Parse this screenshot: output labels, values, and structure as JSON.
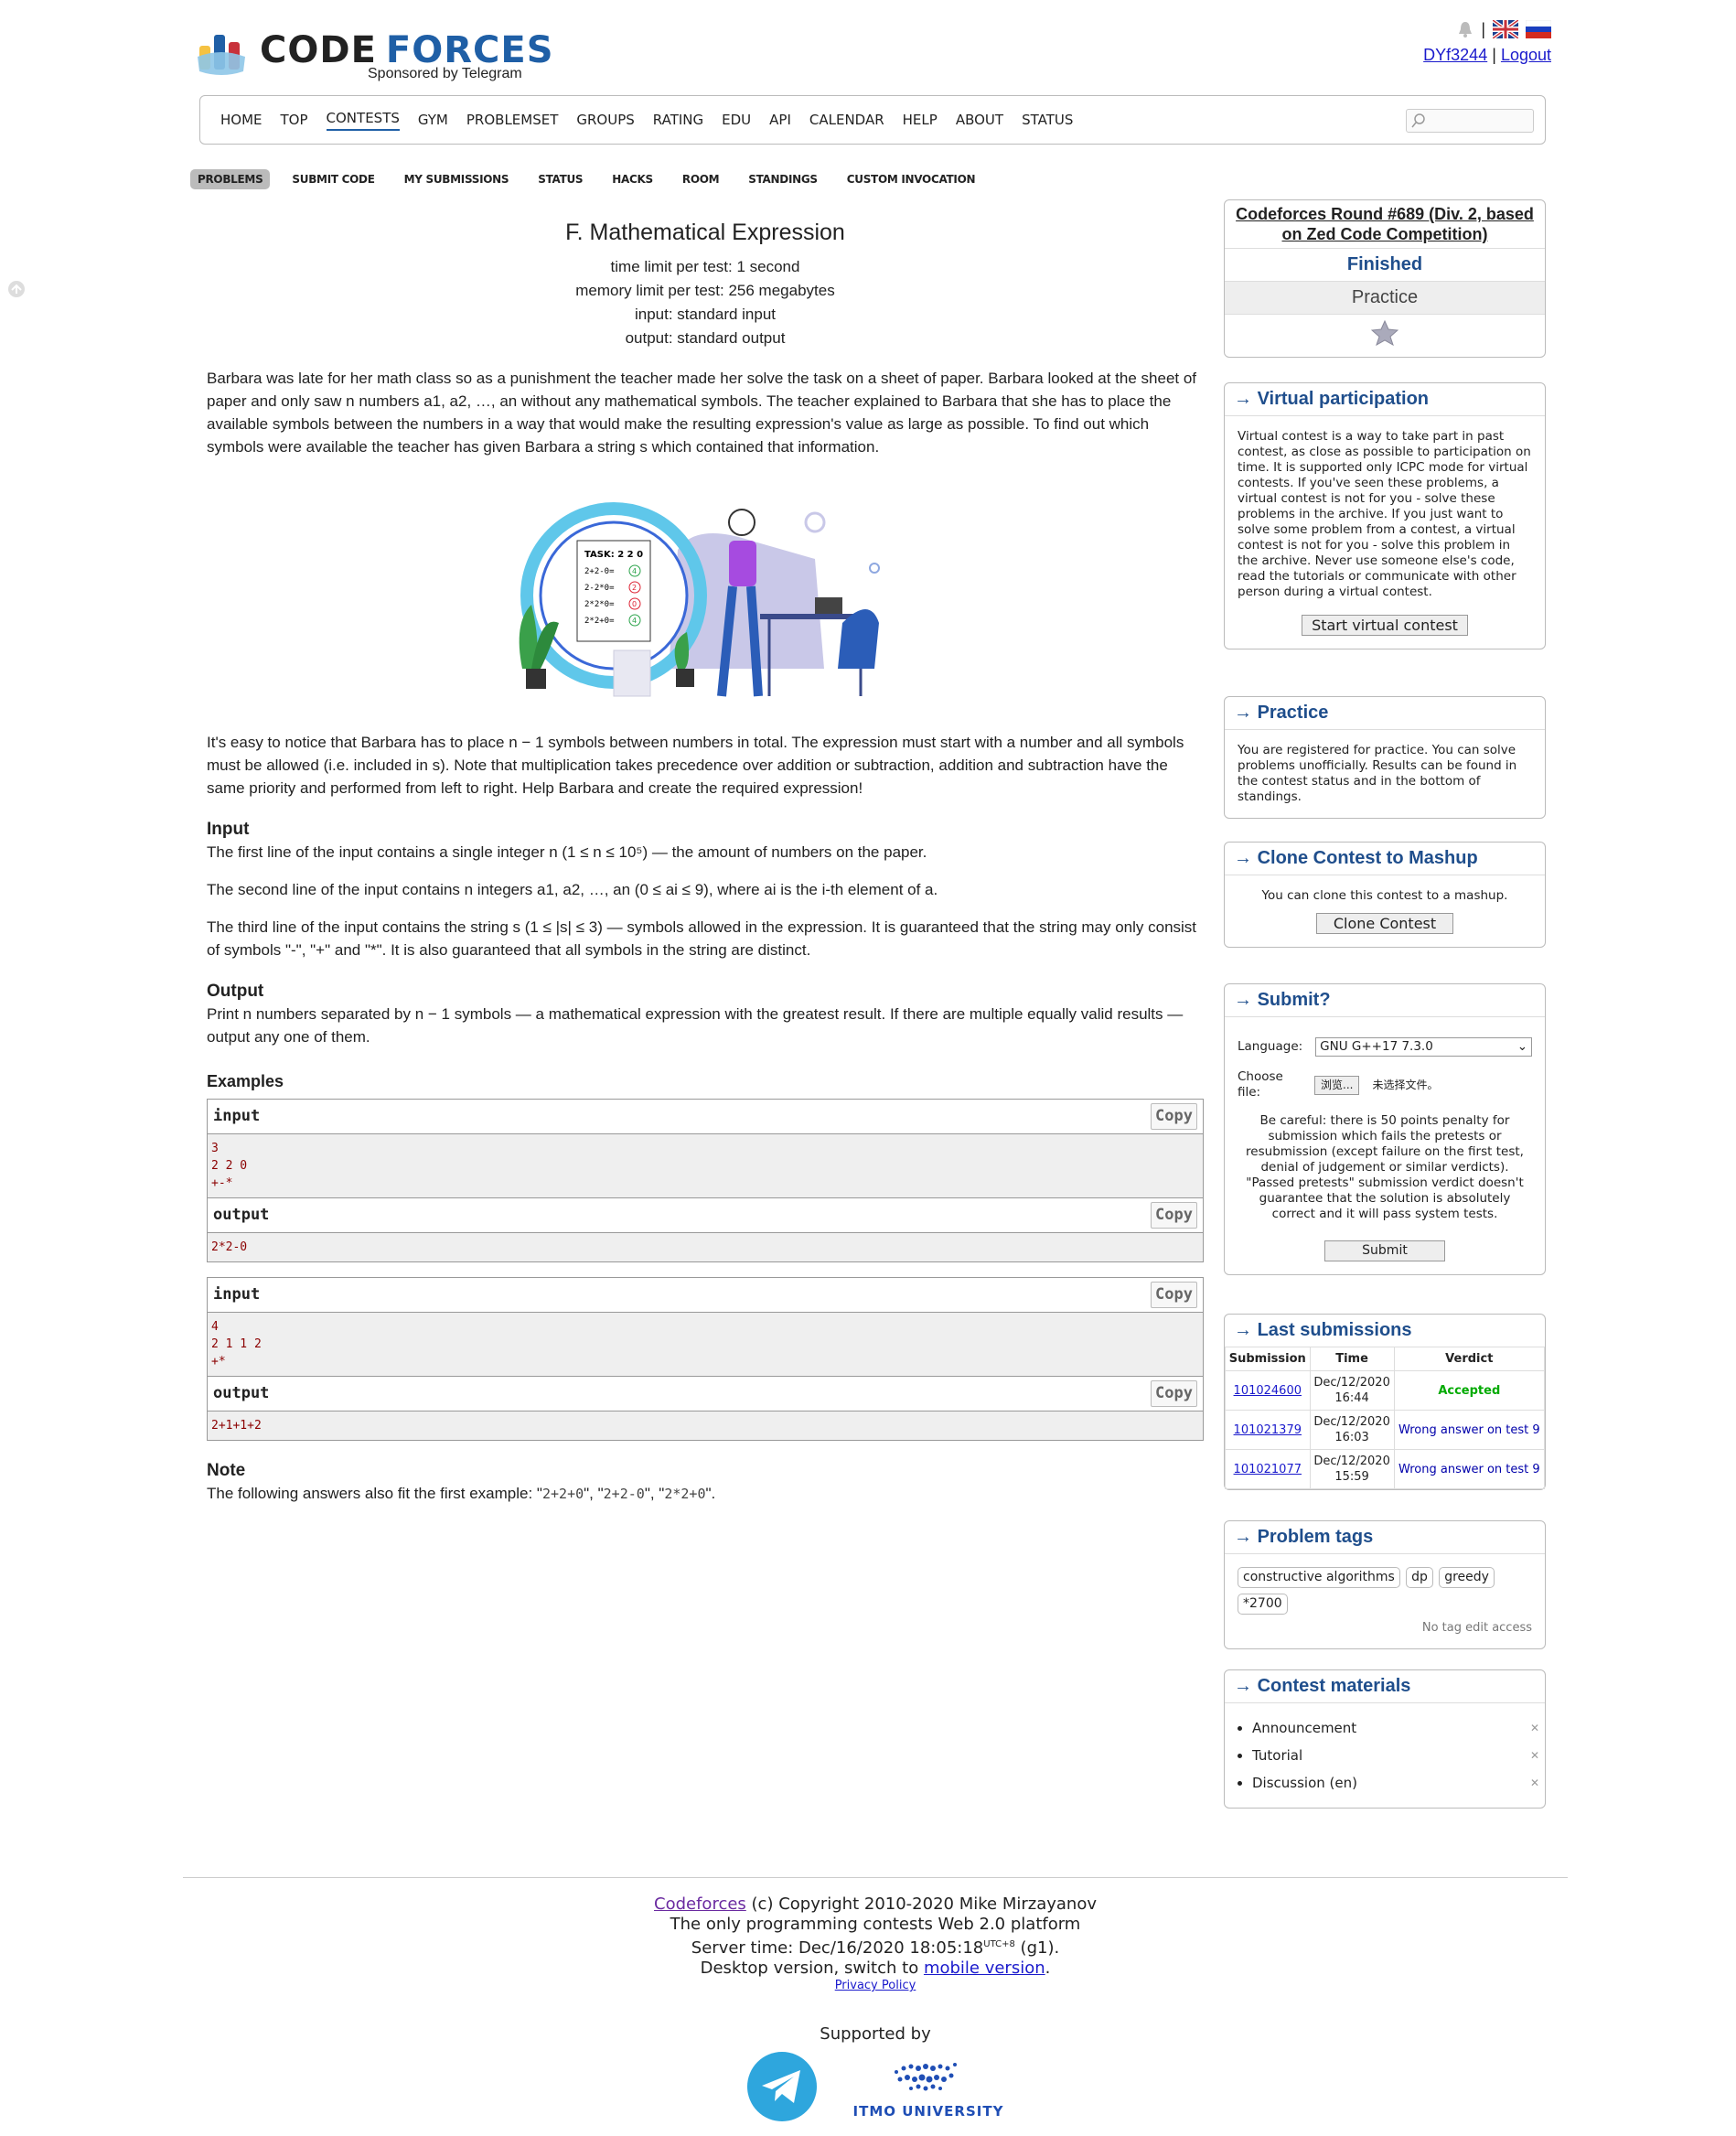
{
  "header": {
    "logo_word1": "CODE",
    "logo_word2": "FORCES",
    "sponsor": "Sponsored by Telegram",
    "username": "DYf3244",
    "separator": "|",
    "logout": "Logout"
  },
  "menu": {
    "items": [
      "HOME",
      "TOP",
      "CONTESTS",
      "GYM",
      "PROBLEMSET",
      "GROUPS",
      "RATING",
      "EDU",
      "API",
      "CALENDAR",
      "HELP",
      "ABOUT",
      "STATUS"
    ],
    "active": "CONTESTS"
  },
  "submenu": {
    "items": [
      "PROBLEMS",
      "SUBMIT CODE",
      "MY SUBMISSIONS",
      "STATUS",
      "HACKS",
      "ROOM",
      "STANDINGS",
      "CUSTOM INVOCATION"
    ],
    "active": "PROBLEMS"
  },
  "problem": {
    "title": "F. Mathematical Expression",
    "time_limit": "time limit per test: 1 second",
    "memory_limit": "memory limit per test: 256 megabytes",
    "input_file": "input: standard input",
    "output_file": "output: standard output",
    "legend1": "Barbara was late for her math class so as a punishment the teacher made her solve the task on a sheet of paper. Barbara looked at the sheet of paper and only saw n numbers a1, a2, …, an without any mathematical symbols. The teacher explained to Barbara that she has to place the available symbols between the numbers in a way that would make the resulting expression's value as large as possible. To find out which symbols were available the teacher has given Barbara a string s which contained that information.",
    "illustration_task": "TASK: 2 2 0",
    "illustration_lines": [
      "2+2-0=",
      "2-2*0=",
      "2*2*0=",
      "2*2+0="
    ],
    "illustration_results": [
      "4",
      "2",
      "0",
      "4"
    ],
    "legend2": "It's easy to notice that Barbara has to place n − 1 symbols between numbers in total. The expression must start with a number and all symbols must be allowed (i.e. included in s). Note that multiplication takes precedence over addition or subtraction, addition and subtraction have the same priority and performed from left to right. Help Barbara and create the required expression!",
    "input_title": "Input",
    "input1": "The first line of the input contains a single integer n (1 ≤ n ≤ 10⁵) — the amount of numbers on the paper.",
    "input2": "The second line of the input contains n integers a1, a2, …, an (0 ≤ ai ≤ 9), where ai is the i-th element of a.",
    "input3": "The third line of the input contains the string s (1 ≤ |s| ≤ 3) — symbols allowed in the expression. It is guaranteed that the string may only consist of symbols \"-\", \"+\" and \"*\". It is also guaranteed that all symbols in the string are distinct.",
    "output_title": "Output",
    "output1": "Print n numbers separated by n − 1 symbols — a mathematical expression with the greatest result. If there are multiple equally valid results — output any one of them.",
    "examples_title": "Examples",
    "input_label": "input",
    "output_label": "output",
    "copy_label": "Copy",
    "examples": [
      {
        "input": "3\n2 2 0\n+-*",
        "output": "2*2-0"
      },
      {
        "input": "4\n2 1 1 2\n+*",
        "output": "2+1+1+2"
      }
    ],
    "note_title": "Note",
    "note_prefix": "The following answers also fit the first example: \"",
    "note_a1": "2+2+0",
    "note_sep": "\", \"",
    "note_a2": "2+2-0",
    "note_a3": "2*2+0",
    "note_suffix": "\"."
  },
  "sidebar": {
    "round": {
      "name": "Codeforces Round #689 (Div. 2, based on Zed Code Competition)",
      "status": "Finished",
      "mode": "Practice"
    },
    "virtual": {
      "caption": "Virtual participation",
      "text": "Virtual contest is a way to take part in past contest, as close as possible to participation on time. It is supported only ICPC mode for virtual contests. If you've seen these problems, a virtual contest is not for you - solve these problems in the archive. If you just want to solve some problem from a contest, a virtual contest is not for you - solve this problem in the archive. Never use someone else's code, read the tutorials or communicate with other person during a virtual contest.",
      "button": "Start virtual contest"
    },
    "practice": {
      "caption": "Practice",
      "text": "You are registered for practice. You can solve problems unofficially. Results can be found in the contest status and in the bottom of standings."
    },
    "clone": {
      "caption": "Clone Contest to Mashup",
      "text": "You can clone this contest to a mashup.",
      "button": "Clone Contest"
    },
    "submit": {
      "caption": "Submit?",
      "language_label": "Language:",
      "language_value": "GNU G++17 7.3.0",
      "file_label": "Choose file:",
      "file_button": "浏览...",
      "file_none": "未选择文件。",
      "warning": "Be careful: there is 50 points penalty for submission which fails the pretests or resubmission (except failure on the first test, denial of judgement or similar verdicts). \"Passed pretests\" submission verdict doesn't guarantee that the solution is absolutely correct and it will pass system tests.",
      "button": "Submit"
    },
    "last": {
      "caption": "Last submissions",
      "headers": [
        "Submission",
        "Time",
        "Verdict"
      ],
      "rows": [
        {
          "id": "101024600",
          "date": "Dec/12/2020",
          "time": "16:44",
          "verdict": "Accepted",
          "ok": true
        },
        {
          "id": "101021379",
          "date": "Dec/12/2020",
          "time": "16:03",
          "verdict": "Wrong answer on test 9",
          "ok": false
        },
        {
          "id": "101021077",
          "date": "Dec/12/2020",
          "time": "15:59",
          "verdict": "Wrong answer on test 9",
          "ok": false
        }
      ]
    },
    "tags": {
      "caption": "Problem tags",
      "items": [
        "constructive algorithms",
        "dp",
        "greedy",
        "*2700"
      ],
      "note": "No tag edit access"
    },
    "materials": {
      "caption": "Contest materials",
      "items": [
        "Announcement",
        "Tutorial",
        "Discussion (en)"
      ]
    }
  },
  "footer": {
    "site": "Codeforces",
    "copyright": " (c) Copyright 2010-2020 Mike Mirzayanov",
    "tagline": "The only programming contests Web 2.0 platform",
    "server_time": "Server time: Dec/16/2020 18:05:18",
    "utc": "UTC+8",
    "g1": " (g1).",
    "desktop": "Desktop version, switch to ",
    "mobile": "mobile version",
    "dot": ".",
    "privacy": "Privacy Policy",
    "supported": "Supported by",
    "itmo": "ITMO UNIVERSITY"
  },
  "colors": {
    "accent": "#1f4e8c",
    "accepted": "#0a0",
    "wrong": "#00a"
  }
}
